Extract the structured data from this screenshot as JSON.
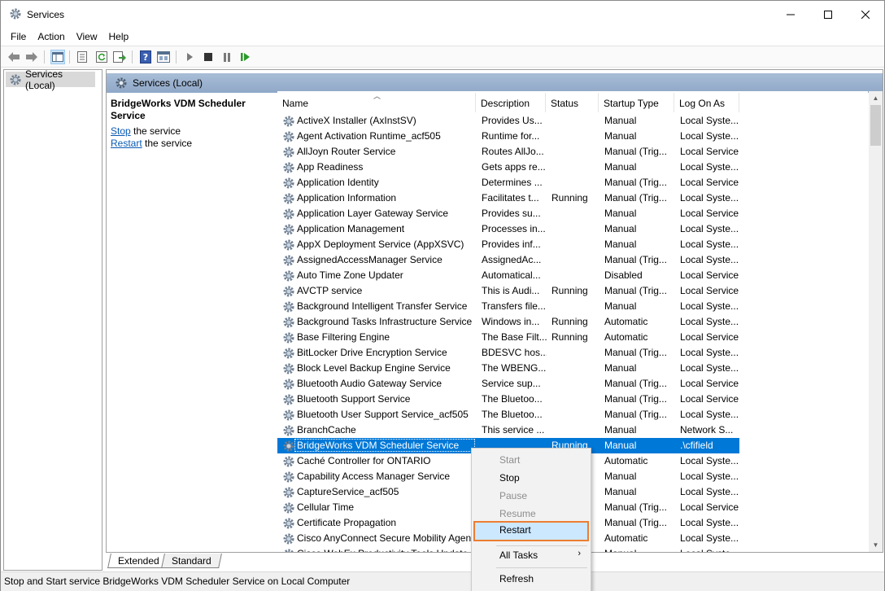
{
  "window": {
    "title": "Services"
  },
  "menu": [
    "File",
    "Action",
    "View",
    "Help"
  ],
  "icons": {
    "app": "gear-icon",
    "back": "back-arrow-icon",
    "forward": "forward-arrow-icon",
    "show_tree": "console-tree-icon",
    "properties": "properties-icon",
    "refresh": "refresh-icon",
    "export": "export-list-icon",
    "help": "help-icon",
    "view": "view-icon",
    "start": "play-icon",
    "stop": "stop-icon",
    "pause": "pause-icon",
    "restart": "restart-icon"
  },
  "colors": {
    "selection": "#0078d7",
    "highlight_border": "#ed7d31",
    "link": "#0a5bb5"
  },
  "tree": {
    "item": "Services (Local)"
  },
  "main": {
    "header": "Services (Local)",
    "selected_service": "BridgeWorks VDM Scheduler Service",
    "actions": [
      {
        "link": "Stop",
        "text": " the service"
      },
      {
        "link": "Restart",
        "text": " the service"
      }
    ]
  },
  "columns": [
    "Name",
    "Description",
    "Status",
    "Startup Type",
    "Log On As"
  ],
  "services": [
    [
      "ActiveX Installer (AxInstSV)",
      "Provides Us...",
      "",
      "Manual",
      "Local Syste..."
    ],
    [
      "Agent Activation Runtime_acf505",
      "Runtime for...",
      "",
      "Manual",
      "Local Syste..."
    ],
    [
      "AllJoyn Router Service",
      "Routes AllJo...",
      "",
      "Manual (Trig...",
      "Local Service"
    ],
    [
      "App Readiness",
      "Gets apps re...",
      "",
      "Manual",
      "Local Syste..."
    ],
    [
      "Application Identity",
      "Determines ...",
      "",
      "Manual (Trig...",
      "Local Service"
    ],
    [
      "Application Information",
      "Facilitates t...",
      "Running",
      "Manual (Trig...",
      "Local Syste..."
    ],
    [
      "Application Layer Gateway Service",
      "Provides su...",
      "",
      "Manual",
      "Local Service"
    ],
    [
      "Application Management",
      "Processes in...",
      "",
      "Manual",
      "Local Syste..."
    ],
    [
      "AppX Deployment Service (AppXSVC)",
      "Provides inf...",
      "",
      "Manual",
      "Local Syste..."
    ],
    [
      "AssignedAccessManager Service",
      "AssignedAc...",
      "",
      "Manual (Trig...",
      "Local Syste..."
    ],
    [
      "Auto Time Zone Updater",
      "Automatical...",
      "",
      "Disabled",
      "Local Service"
    ],
    [
      "AVCTP service",
      "This is Audi...",
      "Running",
      "Manual (Trig...",
      "Local Service"
    ],
    [
      "Background Intelligent Transfer Service",
      "Transfers file...",
      "",
      "Manual",
      "Local Syste..."
    ],
    [
      "Background Tasks Infrastructure Service",
      "Windows in...",
      "Running",
      "Automatic",
      "Local Syste..."
    ],
    [
      "Base Filtering Engine",
      "The Base Filt...",
      "Running",
      "Automatic",
      "Local Service"
    ],
    [
      "BitLocker Drive Encryption Service",
      "BDESVC hos...",
      "",
      "Manual (Trig...",
      "Local Syste..."
    ],
    [
      "Block Level Backup Engine Service",
      "The WBENG...",
      "",
      "Manual",
      "Local Syste..."
    ],
    [
      "Bluetooth Audio Gateway Service",
      "Service sup...",
      "",
      "Manual (Trig...",
      "Local Service"
    ],
    [
      "Bluetooth Support Service",
      "The Bluetoo...",
      "",
      "Manual (Trig...",
      "Local Service"
    ],
    [
      "Bluetooth User Support Service_acf505",
      "The Bluetoo...",
      "",
      "Manual (Trig...",
      "Local Syste..."
    ],
    [
      "BranchCache",
      "This service ...",
      "",
      "Manual",
      "Network S..."
    ],
    [
      "BridgeWorks VDM Scheduler Service",
      "",
      "Running",
      "Manual",
      ".\\cfifield"
    ],
    [
      "Caché Controller for ONTARIO",
      "",
      "",
      "Automatic",
      "Local Syste..."
    ],
    [
      "Capability Access Manager Service",
      "",
      "",
      "Manual",
      "Local Syste..."
    ],
    [
      "CaptureService_acf505",
      "",
      "",
      "Manual",
      "Local Syste..."
    ],
    [
      "Cellular Time",
      "",
      "",
      "Manual (Trig...",
      "Local Service"
    ],
    [
      "Certificate Propagation",
      "",
      "",
      "Manual (Trig...",
      "Local Syste..."
    ],
    [
      "Cisco AnyConnect Secure Mobility Agent",
      "",
      "",
      "Automatic",
      "Local Syste..."
    ],
    [
      "Cisco WebEx Productivity Tools Update",
      "",
      "",
      "Manual",
      "Local Syste..."
    ]
  ],
  "selected_index": 21,
  "context_menu": {
    "items": [
      {
        "label": "Start",
        "enabled": false
      },
      {
        "label": "Stop",
        "enabled": true
      },
      {
        "label": "Pause",
        "enabled": false
      },
      {
        "label": "Resume",
        "enabled": false
      },
      {
        "label": "Restart",
        "enabled": true,
        "highlighted": true
      },
      {
        "label": "All Tasks",
        "enabled": true,
        "submenu": true
      },
      {
        "label": "Refresh",
        "enabled": true
      }
    ]
  },
  "tabs": [
    "Extended",
    "Standard"
  ],
  "status_bar": "Stop and Start service BridgeWorks VDM Scheduler Service on Local Computer"
}
